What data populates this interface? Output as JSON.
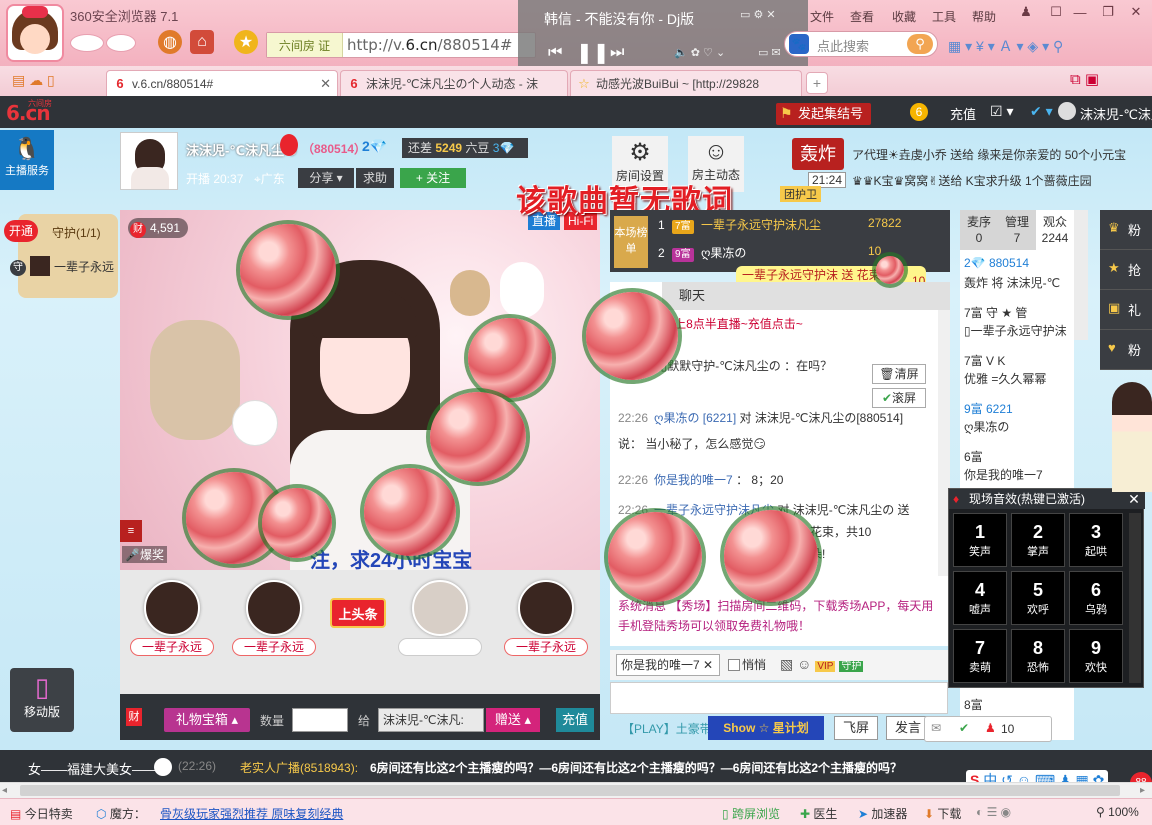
{
  "browser": {
    "title": "360安全浏览器 7.1",
    "addr_tag": "六间房 证",
    "url_prefix": "http://v.",
    "url_host": "6.cn",
    "url_path": "/880514#",
    "search_placeholder": "点此搜索",
    "menu": [
      "文件",
      "查看",
      "收藏",
      "工具",
      "帮助"
    ],
    "media": {
      "song": "韩信 - 不能没有你 - Dj版"
    },
    "tabs": [
      {
        "label": "v.6.cn/880514#",
        "active": true
      },
      {
        "label": "沫沫児-℃沫凡尘の个人动态 - 沫",
        "active": false
      },
      {
        "label": "动感光波BuiBui ~ [http://29828",
        "active": false
      }
    ],
    "add_tab": "+"
  },
  "site": {
    "logo": "6.cn",
    "logo_sub": "六间房",
    "rally": "发起集结号",
    "coins": "6",
    "recharge": "充值",
    "user": "沫沫児-℃沫凡"
  },
  "room": {
    "qq_service": "主播服务",
    "host_name": "沫沫児-℃沫凡尘の",
    "room_id": "（880514）",
    "level": "2💎",
    "gap_prefix": "还差",
    "gap_value": "5249",
    "gap_suffix": "六豆",
    "gap_level": "3💎",
    "live_since": "开播 20:37",
    "location": "广东",
    "share": "分享 ▾",
    "ask": "求助",
    "follow": "+ 关注",
    "room_settings": "房间设置",
    "host_activity": "房主动态",
    "boom": "轰炸",
    "ticker_time": "21:24",
    "guard_team": "团护卫",
    "ticker_1": "ア代理☀垚虔小乔 送给 缘来是你亲爱的 50个小元宝",
    "ticker_2": "♛♛K宝♛窝窝✌送给 K宝求升级 1个蔷薇庄园",
    "no_lyric": "该歌曲暂无歌词"
  },
  "guard": {
    "open": "开通",
    "count": "守护(1/1)",
    "member": "一辈子永远"
  },
  "video": {
    "wealth": "4,591",
    "live": "直播",
    "hifi": "Hi-Fi",
    "scroll": "注，求24小时宝宝",
    "explode": "爆奖"
  },
  "seats": [
    {
      "label": "一辈子永远"
    },
    {
      "label": "一辈子永远"
    },
    {
      "label": ""
    },
    {
      "label": "一辈子永远"
    }
  ],
  "headline_sign": "上头条",
  "giftbar": {
    "wealth": "财",
    "gift_box": "礼物宝箱 ▴",
    "qty": "数量",
    "to": "给",
    "to_value": "沫沫児-℃沫凡:",
    "send": "赠送 ▴",
    "recharge": "充值"
  },
  "mobile": "移动版",
  "rank": {
    "label": "本场榜单",
    "rows": [
      {
        "pos": "1",
        "vip": "7富",
        "name": "一辈子永远守护沫凡尘",
        "score": "27822"
      },
      {
        "pos": "2",
        "vip": "9富",
        "name": "ღ果冻の",
        "score": "10"
      }
    ],
    "gift_notice": "一辈子永远守护沫 送 花束",
    "gift_count": "10个"
  },
  "chat": {
    "tabs": [
      "",
      "聊天",
      ""
    ],
    "announce": "❥❥每天晚上8点半直播~充值点击~",
    "lines": [
      {
        "time": "",
        "name": "",
        "text": "轰炸 将 ▯默默守护-℃沫凡尘の ：在吗？"
      },
      {
        "time": "22:26",
        "name": "ღ果冻の [6221]",
        "text": "对 沫沫児-℃沫凡尘の[880514]"
      },
      {
        "time": "",
        "name": "",
        "text": "说： 当小秘了，怎么感觉😏"
      },
      {
        "time": "22:26",
        "name": "你是我的唯一7",
        "text": "： 8；20"
      },
      {
        "time": "22:26",
        "name": "一辈子永远守护沫凡尘",
        "text": "对 沫沫児-℃沫凡尘の 送"
      },
      {
        "time": "",
        "name": "",
        "text": "花束，共10"
      },
      {
        "time": "",
        "name": "",
        "text": "朵!"
      }
    ],
    "clear": "清屏",
    "scroll": "滚屏",
    "sys_msg": "系统消息 【秀场】扫描房间二维码，下载秀场APP，每天用手机登陆秀场可以领取免费礼物哦！",
    "target": "你是我的唯一7 ✕",
    "whisper": "悄悄",
    "play_label": "【PLAY】土豪带",
    "fly": "飞屏",
    "send": "发言"
  },
  "audience": {
    "tabs": [
      {
        "label": "麦序",
        "count": "0"
      },
      {
        "label": "管理",
        "count": "7"
      },
      {
        "label": "观众",
        "count": "2244"
      }
    ],
    "rows": [
      {
        "text": "2💎 880514"
      },
      {
        "text": "轰炸 将 沫沫児-℃"
      },
      {
        "text": "7富 守 ★ 管"
      },
      {
        "text": "▯一辈子永远守护沫"
      },
      {
        "text": "7富 V K"
      },
      {
        "text": "优雅 =久久幂幂"
      },
      {
        "text": "9富 6221"
      },
      {
        "text": "ღ果冻の"
      },
      {
        "text": "6富"
      },
      {
        "text": "你是我的唯一7"
      },
      {
        "text": "8富"
      }
    ]
  },
  "right_strip": [
    "粉",
    "抢",
    "礼",
    "粉"
  ],
  "sfx": {
    "title": "现场音效(热键已激活)",
    "keys": [
      {
        "n": "1",
        "l": "笑声"
      },
      {
        "n": "2",
        "l": "掌声"
      },
      {
        "n": "3",
        "l": "起哄"
      },
      {
        "n": "4",
        "l": "嘘声"
      },
      {
        "n": "5",
        "l": "欢呼"
      },
      {
        "n": "6",
        "l": "乌鸦"
      },
      {
        "n": "7",
        "l": "卖萌"
      },
      {
        "n": "8",
        "l": "恐怖"
      },
      {
        "n": "9",
        "l": "欢快"
      }
    ]
  },
  "notice": {
    "left": "女——福建大美女——",
    "time": "(22:26)",
    "source": "老实人广播(8518943):",
    "text": "6房间还有比这2个主播瘦的吗？—6房间还有比这2个主播瘦的吗？—6房间还有比这2个主播瘦的吗？"
  },
  "mini_bar": {
    "count": "10"
  },
  "statusbar": {
    "today": "今日特卖",
    "magic": "魔方：",
    "promo": "骨灰级玩家强烈推荐 原味复刻经典",
    "cross": "跨屏浏览",
    "doctor": "医生",
    "accel": "加速器",
    "download": "下载",
    "zoom": "100%"
  },
  "colors": {
    "accent": "#e9242d",
    "chrome_pink": "#f3b1bf",
    "dark_bar": "#2f3338"
  }
}
